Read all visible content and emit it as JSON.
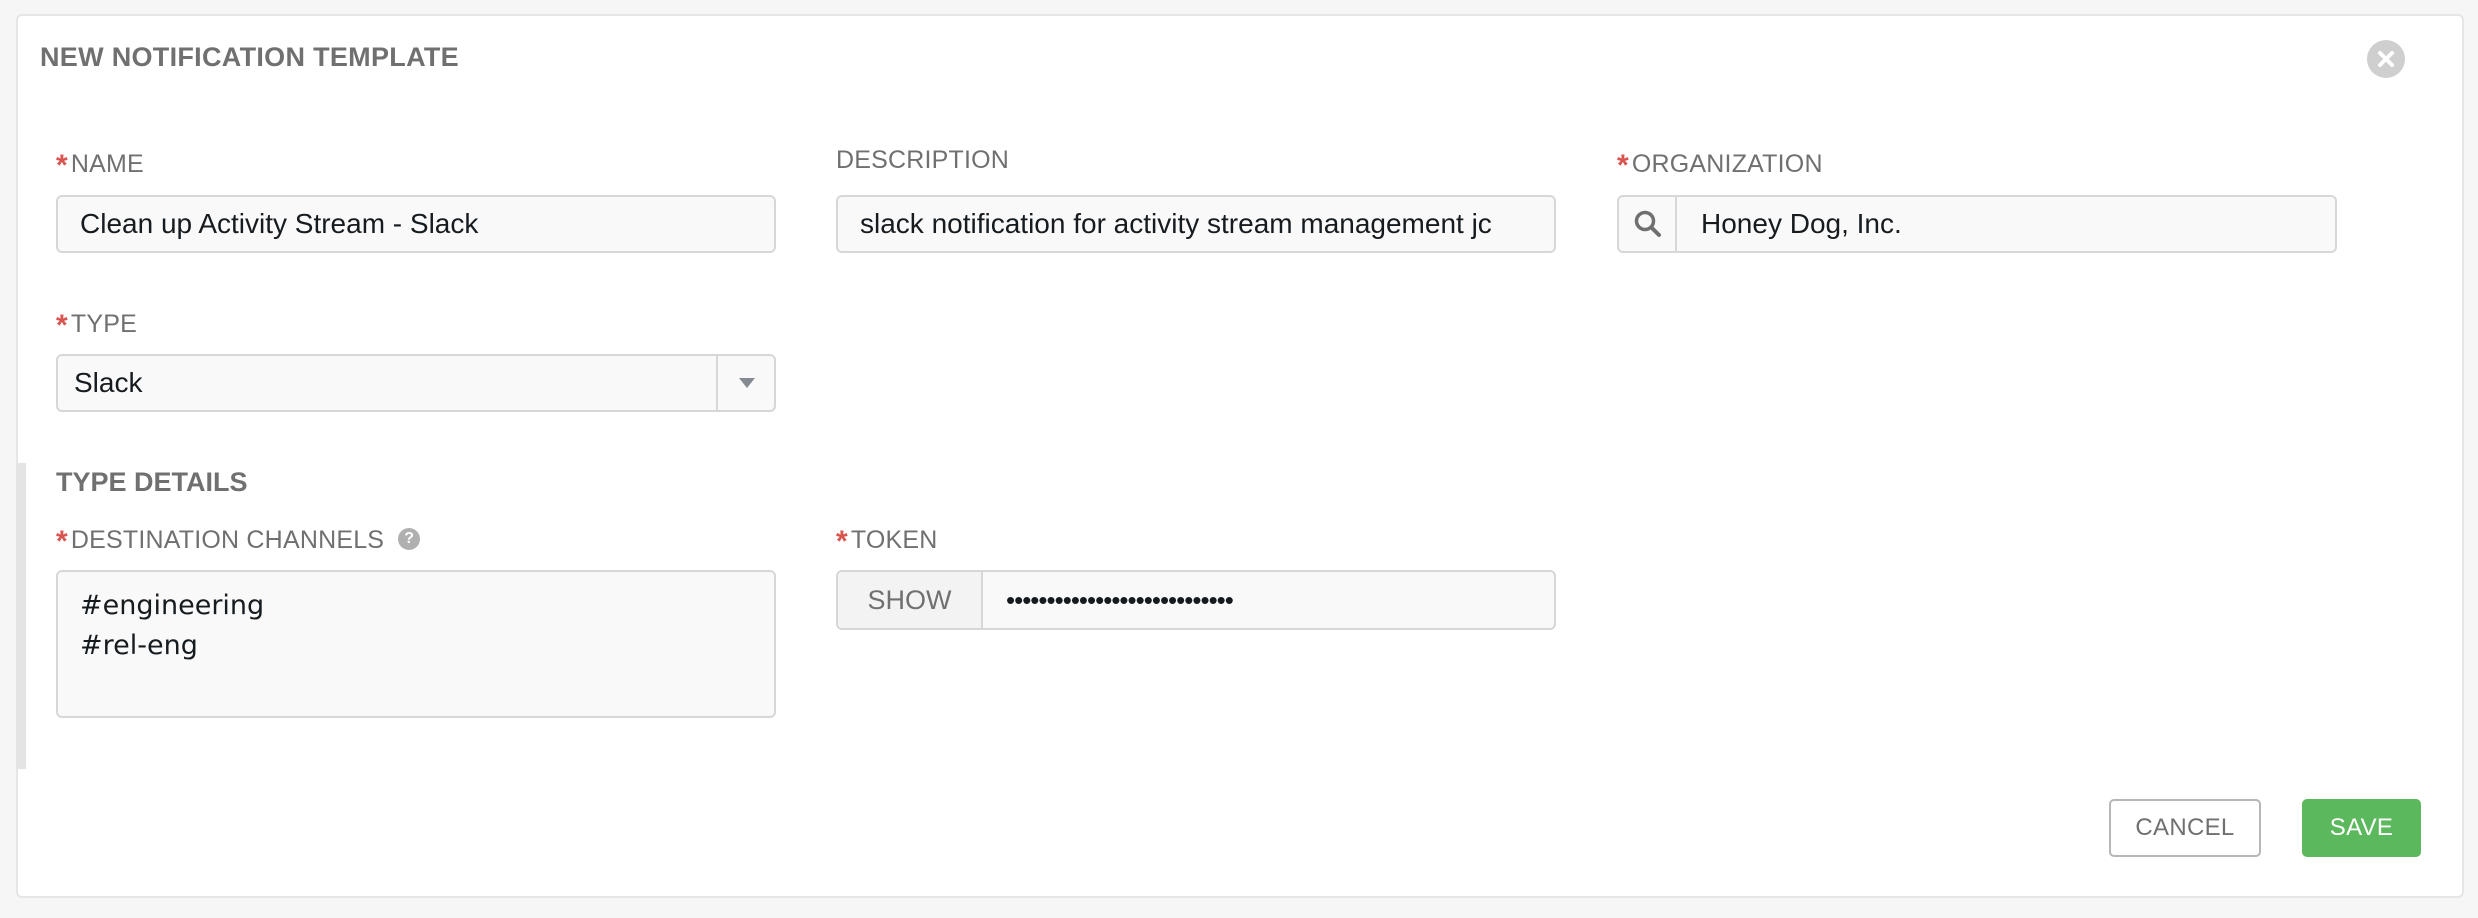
{
  "dialog": {
    "title": "NEW NOTIFICATION TEMPLATE"
  },
  "fields": {
    "name": {
      "label": "NAME",
      "required": true,
      "value": "Clean up Activity Stream - Slack"
    },
    "description": {
      "label": "DESCRIPTION",
      "required": false,
      "value": "slack notification for activity stream management jc"
    },
    "organization": {
      "label": "ORGANIZATION",
      "required": true,
      "value": "Honey Dog, Inc.",
      "icon": "search-icon"
    },
    "type": {
      "label": "TYPE",
      "required": true,
      "value": "Slack",
      "icon": "caret-down-icon"
    }
  },
  "type_details": {
    "title": "TYPE DETAILS",
    "destination_channels": {
      "label": "DESTINATION CHANNELS",
      "required": true,
      "lines": [
        "#engineering",
        "#rel-eng"
      ],
      "help_icon": "question-circle-icon",
      "help_glyph": "?"
    },
    "token": {
      "label": "TOKEN",
      "required": true,
      "show_label": "SHOW",
      "masked_value": "••••••••••••••••••••••••••••"
    }
  },
  "actions": {
    "cancel_label": "CANCEL",
    "save_label": "SAVE"
  },
  "colors": {
    "required_asterisk": "#d9534f",
    "save_button": "#5cb85c",
    "label_text": "#707070"
  }
}
